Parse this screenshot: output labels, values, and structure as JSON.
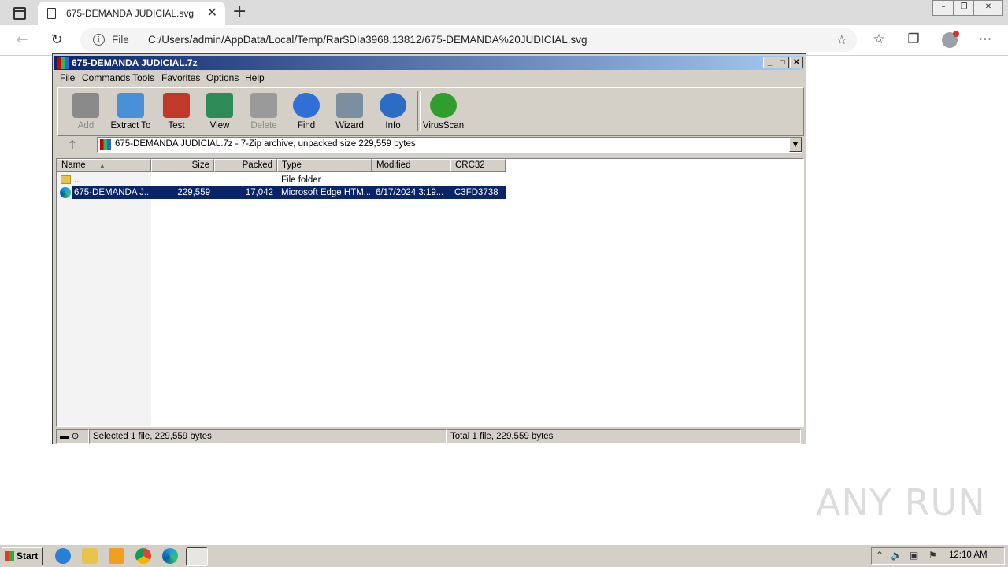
{
  "browser": {
    "tab_title": "675-DEMANDA JUDICIAL.svg",
    "new_tab_symbol": "+",
    "close_symbol": "✕",
    "file_label": "File",
    "url": "C:/Users/admin/AppData/Local/Temp/Rar$DIa3968.13812/675-DEMANDA%20JUDICIAL.svg",
    "back_symbol": "←",
    "reload_symbol": "↻",
    "more_symbol": "⋯"
  },
  "winrar": {
    "title": "675-DEMANDA JUDICIAL.7z",
    "menu": [
      "File",
      "Commands",
      "Tools",
      "Favorites",
      "Options",
      "Help"
    ],
    "toolbar": [
      {
        "label": "Add",
        "icon": "add-archive-icon",
        "enabled": false,
        "color": "#8a8a8a"
      },
      {
        "label": "Extract To",
        "icon": "extract-folder-icon",
        "enabled": true,
        "color": "#4a90d9"
      },
      {
        "label": "Test",
        "icon": "test-clipboard-icon",
        "enabled": true,
        "color": "#c0392b"
      },
      {
        "label": "View",
        "icon": "view-book-icon",
        "enabled": true,
        "color": "#2e8b57"
      },
      {
        "label": "Delete",
        "icon": "trash-icon",
        "enabled": false,
        "color": "#9a9a9a"
      },
      {
        "label": "Find",
        "icon": "magnifier-icon",
        "enabled": true,
        "color": "#2f6fd6"
      },
      {
        "label": "Wizard",
        "icon": "wand-icon",
        "enabled": true,
        "color": "#7c8fa0"
      },
      {
        "label": "Info",
        "icon": "info-icon",
        "enabled": true,
        "color": "#2b6cc4"
      },
      {
        "label": "VirusScan",
        "icon": "virus-bug-icon",
        "enabled": true,
        "color": "#2f9e2f"
      }
    ],
    "path": "675-DEMANDA JUDICIAL.7z - 7-Zip archive, unpacked size 229,559 bytes",
    "columns": [
      "Name",
      "Size",
      "Packed",
      "Type",
      "Modified",
      "CRC32"
    ],
    "rows": [
      {
        "name": "..",
        "size": "",
        "packed": "",
        "type": "File folder",
        "modified": "",
        "crc": "",
        "selected": false
      },
      {
        "name": "675-DEMANDA J...",
        "size": "229,559",
        "packed": "17,042",
        "type": "Microsoft Edge HTM...",
        "modified": "6/17/2024 3:19...",
        "crc": "C3FD3738",
        "selected": true
      }
    ],
    "status_left": "Selected 1 file, 229,559 bytes",
    "status_right": "Total 1 file, 229,559 bytes"
  },
  "watermark": "ANY RUN",
  "taskbar": {
    "start_label": "Start",
    "clock": "12:10 AM"
  }
}
